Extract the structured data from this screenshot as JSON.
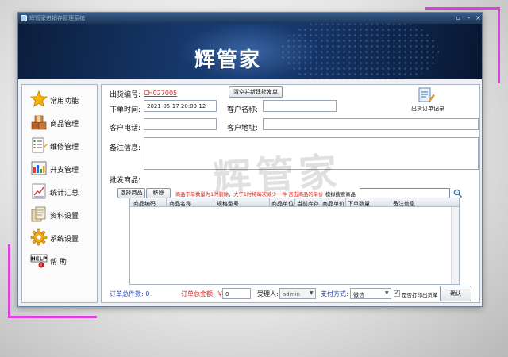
{
  "window": {
    "title": "辉管家进销存管理系统",
    "controls": [
      "restore-icon",
      "minimize-icon",
      "close-icon"
    ]
  },
  "banner": {
    "title": "辉管家"
  },
  "sidebar": {
    "items": [
      {
        "label": "常用功能",
        "icon": "star-icon"
      },
      {
        "label": "商品管理",
        "icon": "boxes-icon"
      },
      {
        "label": "维修管理",
        "icon": "checklist-icon"
      },
      {
        "label": "开支管理",
        "icon": "ledger-icon"
      },
      {
        "label": "统计汇总",
        "icon": "chart-icon"
      },
      {
        "label": "资料设置",
        "icon": "documents-icon"
      },
      {
        "label": "系统设置",
        "icon": "gear-icon"
      },
      {
        "label": "帮  助",
        "icon": "help-icon"
      }
    ]
  },
  "form": {
    "order_no_label": "出货编号:",
    "order_no_value": "CH027005",
    "clear_button": "清空并新建批发单",
    "order_time_label": "下单时间:",
    "order_time_value": "2021-05-17 20:09:12",
    "customer_name_label": "客户名称:",
    "customer_name_value": "",
    "customer_phone_label": "客户电话:",
    "customer_phone_value": "",
    "customer_address_label": "客户地址:",
    "customer_address_value": "",
    "notes_label": "备注信息:",
    "notes_value": "",
    "records_label": "出货订单记录",
    "records_icon": "document-edit-icon",
    "goods_label": "批发商品:"
  },
  "goods": {
    "select_button": "选择商品",
    "remove_button": "移除",
    "hint": "商品下单数量为1时删除，大于1时将每次减少一件 否击商品的单价",
    "search_label": "模拟搜索商品",
    "search_value": "",
    "search_icon": "magnifier-icon",
    "columns": [
      "商品编码",
      "商品名称",
      "规格型号",
      "商品单位",
      "当前库存",
      "商品单价",
      "下单数量",
      "备注信息"
    ],
    "rows": []
  },
  "footer": {
    "count_label": "订单总件数: 0",
    "amount_label": "订单总金额: ￥",
    "amount_value": "0",
    "handler_label": "受理人:",
    "handler_value": "admin",
    "payment_label": "支付方式:",
    "payment_value": "微信",
    "print_checkbox_label": "是否打印出货单",
    "print_checked": true,
    "confirm_button": "确认"
  },
  "watermark": "辉管家",
  "colors": {
    "link_red": "#d6281e",
    "hint_red": "#e0261b",
    "footer_blue": "#1f49b8",
    "footer_red": "#d02020",
    "banner_dark": "#0b1d3c"
  }
}
